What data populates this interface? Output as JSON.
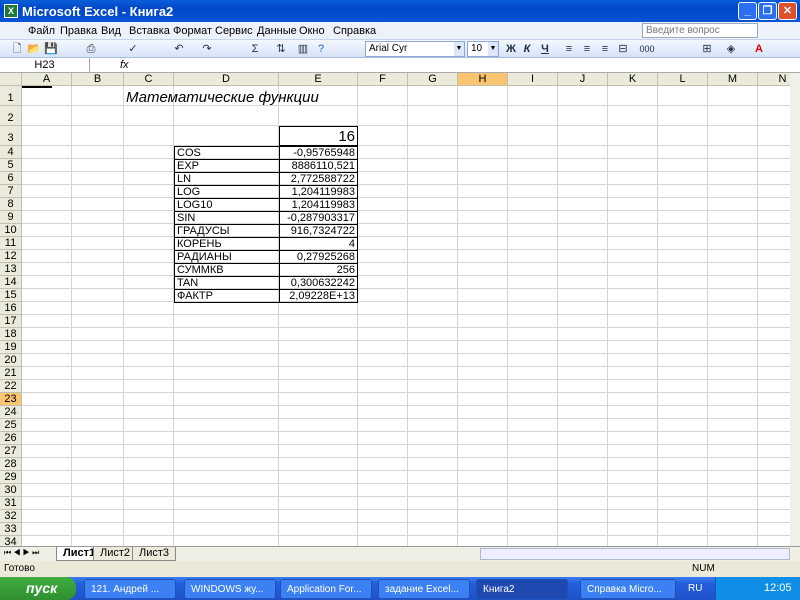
{
  "window": {
    "title": "Microsoft Excel - Книга2",
    "minimize": "_",
    "restore": "❐",
    "close": "✕"
  },
  "menu": [
    "Файл",
    "Правка",
    "Вид",
    "Вставка",
    "Формат",
    "Сервис",
    "Данные",
    "Окно",
    "Справка"
  ],
  "ask_placeholder": "Введите вопрос",
  "toolbar": {
    "font": "Arial Cyr",
    "size": "10",
    "bold": "Ж",
    "italic": "К",
    "underline": "Ч",
    "thousands": "000"
  },
  "namebox": "H23",
  "fx": "fx",
  "columns": [
    "A",
    "B",
    "C",
    "D",
    "E",
    "F",
    "G",
    "H",
    "I",
    "J",
    "K",
    "L",
    "M",
    "N"
  ],
  "selected_cell": "H23",
  "title_cell": "Математические функции",
  "input_value": "16",
  "functions": [
    {
      "name": "COS",
      "value": "-0,95765948"
    },
    {
      "name": "EXP",
      "value": "8886110,521"
    },
    {
      "name": "LN",
      "value": "2,772588722"
    },
    {
      "name": "LOG",
      "value": "1,204119983"
    },
    {
      "name": "LOG10",
      "value": "1,204119983"
    },
    {
      "name": "SIN",
      "value": "-0,287903317"
    },
    {
      "name": "ГРАДУСЫ",
      "value": "916,7324722"
    },
    {
      "name": "КОРЕНЬ",
      "value": "4"
    },
    {
      "name": "РАДИАНЫ",
      "value": "0,27925268"
    },
    {
      "name": "СУММКВ",
      "value": "256"
    },
    {
      "name": "TAN",
      "value": "0,300632242"
    },
    {
      "name": "ФАКТР",
      "value": "2,09228E+13"
    }
  ],
  "sheets": [
    "Лист1",
    "Лист2",
    "Лист3"
  ],
  "status": {
    "ready": "Готово",
    "num": "NUM"
  },
  "taskbar": {
    "start": "пуск",
    "tasks": [
      "121. Андрей ...",
      "WINDOWS жу...",
      "Application For...",
      "задание Excel...",
      "Книга2",
      "Справка Micro..."
    ],
    "lang": "RU",
    "clock": "12:05"
  }
}
